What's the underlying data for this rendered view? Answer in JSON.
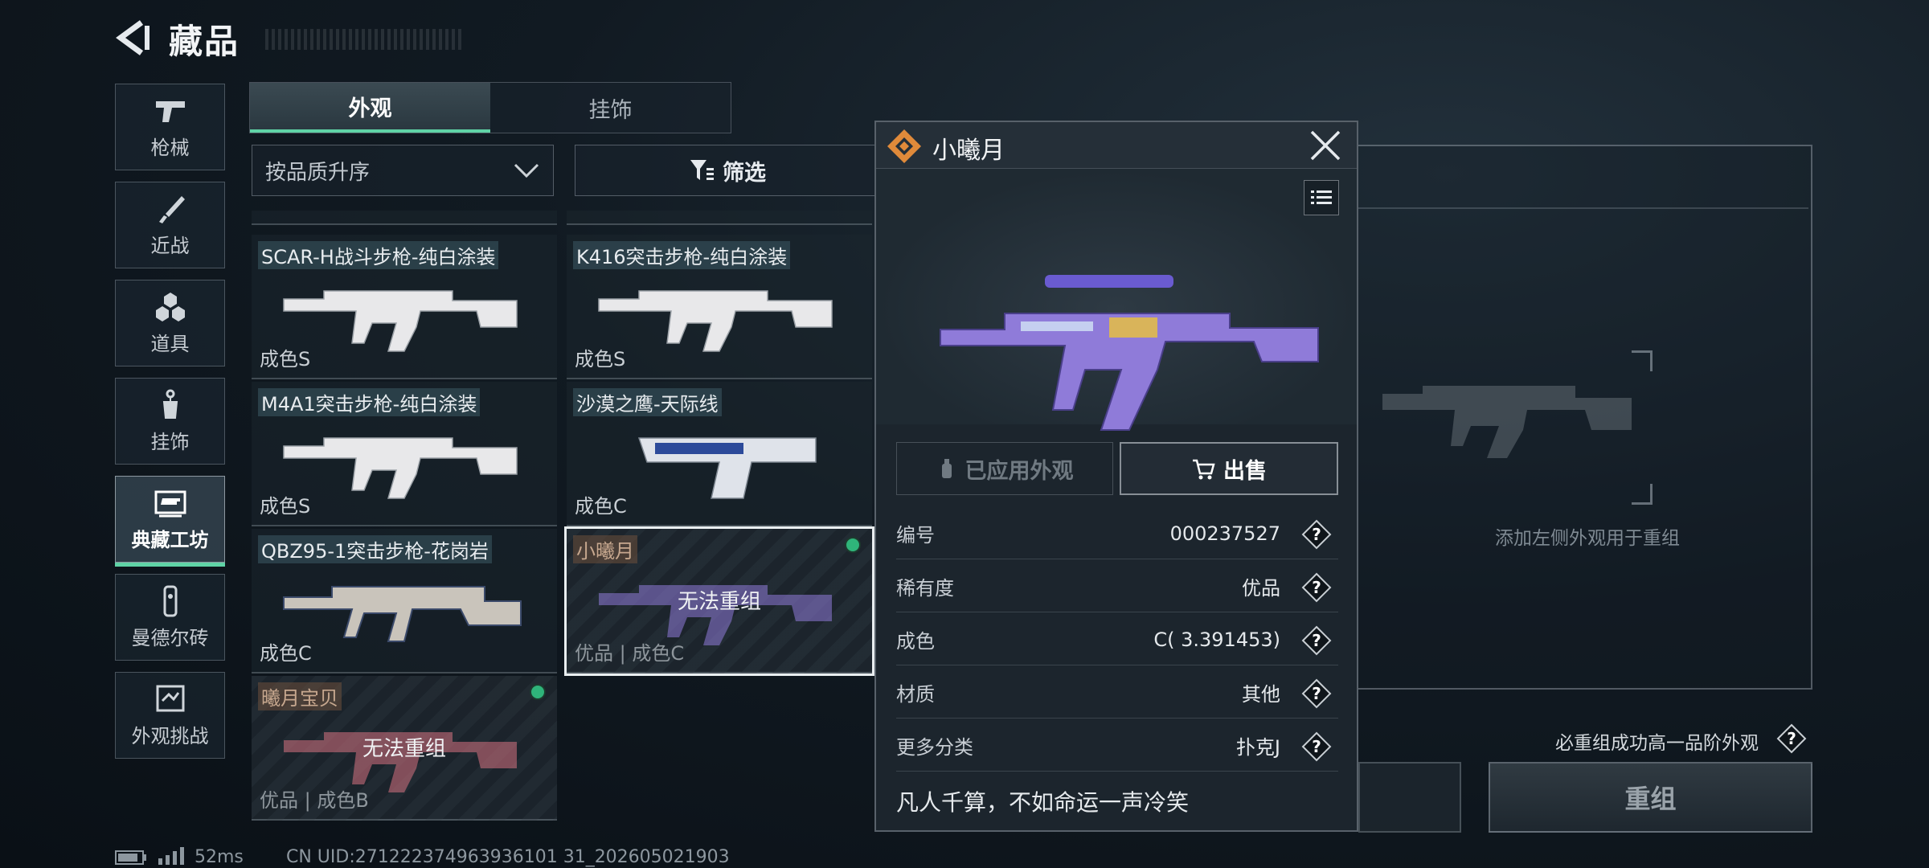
{
  "header": {
    "title": "藏品"
  },
  "nav": [
    {
      "label": "枪械",
      "icon": "pistol-icon"
    },
    {
      "label": "近战",
      "icon": "knife-icon"
    },
    {
      "label": "道具",
      "icon": "grenades-icon"
    },
    {
      "label": "挂饰",
      "icon": "charm-icon"
    },
    {
      "label": "典藏工坊",
      "icon": "workshop-icon",
      "active": true
    },
    {
      "label": "曼德尔砖",
      "icon": "brick-icon"
    },
    {
      "label": "外观挑战",
      "icon": "challenge-icon"
    }
  ],
  "tabs": [
    {
      "label": "外观",
      "active": true
    },
    {
      "label": "挂饰",
      "active": false
    }
  ],
  "sort": {
    "label": "按品质升序"
  },
  "filter": {
    "label": "筛选"
  },
  "items": [
    {
      "name": "SCAR-H战斗步枪-纯白涂装",
      "grade": "成色S",
      "color": "#e8e8ea"
    },
    {
      "name": "K416突击步枪-纯白涂装",
      "grade": "成色S",
      "color": "#e8e8ea"
    },
    {
      "name": "M4A1突击步枪-纯白涂装",
      "grade": "成色S",
      "color": "#e8e8ea"
    },
    {
      "name": "沙漠之鹰-天际线",
      "grade": "成色C",
      "color": "#dfe3ea"
    },
    {
      "name": "QBZ95-1突击步枪-花岗岩",
      "grade": "成色C",
      "color": "#c9c4bb"
    },
    {
      "name": "小曦月",
      "grade": "优品 | 成色C",
      "status": "无法重组",
      "color": "#8f7bd9"
    },
    {
      "name": "曦月宝贝",
      "grade": "优品 | 成色B",
      "status": "无法重组",
      "color": "#c76c7a"
    }
  ],
  "detail": {
    "title": "小曦月",
    "applied_label": "已应用外观",
    "sell_label": "出售",
    "rows": [
      {
        "key": "编号",
        "value": "000237527"
      },
      {
        "key": "稀有度",
        "value": "优品"
      },
      {
        "key": "成色",
        "value": "C( 3.391453)"
      },
      {
        "key": "材质",
        "value": "其他"
      },
      {
        "key": "更多分类",
        "value": "扑克J"
      }
    ],
    "motto": "凡人千算，不如命运一声冷笑"
  },
  "recombine": {
    "hint": "添加左侧外观用于重组",
    "must_text": "必重组成功高一品阶外观",
    "button_label": "重组"
  },
  "footer": {
    "ping": "52ms",
    "uid": "CN UID:271222374963936101 31_202605021903"
  },
  "colors": {
    "accent": "#5fd3a6",
    "owned_dot": "#2fb47a",
    "logo": "#e08a3a"
  }
}
